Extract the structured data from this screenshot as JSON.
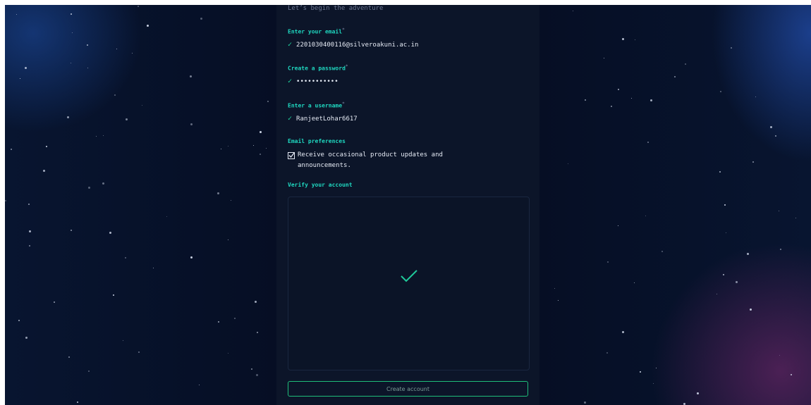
{
  "signup": {
    "tagline": "Let’s begin the adventure",
    "email": {
      "label": "Enter your email",
      "required_mark": "*",
      "value": "2201030400116@silveroakuni.ac.in"
    },
    "password": {
      "label": "Create a password",
      "required_mark": "*",
      "value": "•••••••••••"
    },
    "username": {
      "label": "Enter a username",
      "required_mark": "*",
      "value": "RanjeetLohar6617"
    },
    "preferences": {
      "label": "Email preferences",
      "checkbox_checked": true,
      "checkbox_text": "Receive occasional product updates and announcements."
    },
    "verify": {
      "label": "Verify your account",
      "status": "verified"
    },
    "create_button_label": "Create account"
  },
  "icons": {
    "valid": "check-icon",
    "verified": "checkmark-icon"
  },
  "colors": {
    "accent": "#1fd8c0",
    "success": "#1fd8a0",
    "button_border": "#1fbf7a",
    "panel_bg": "#0c1529"
  }
}
